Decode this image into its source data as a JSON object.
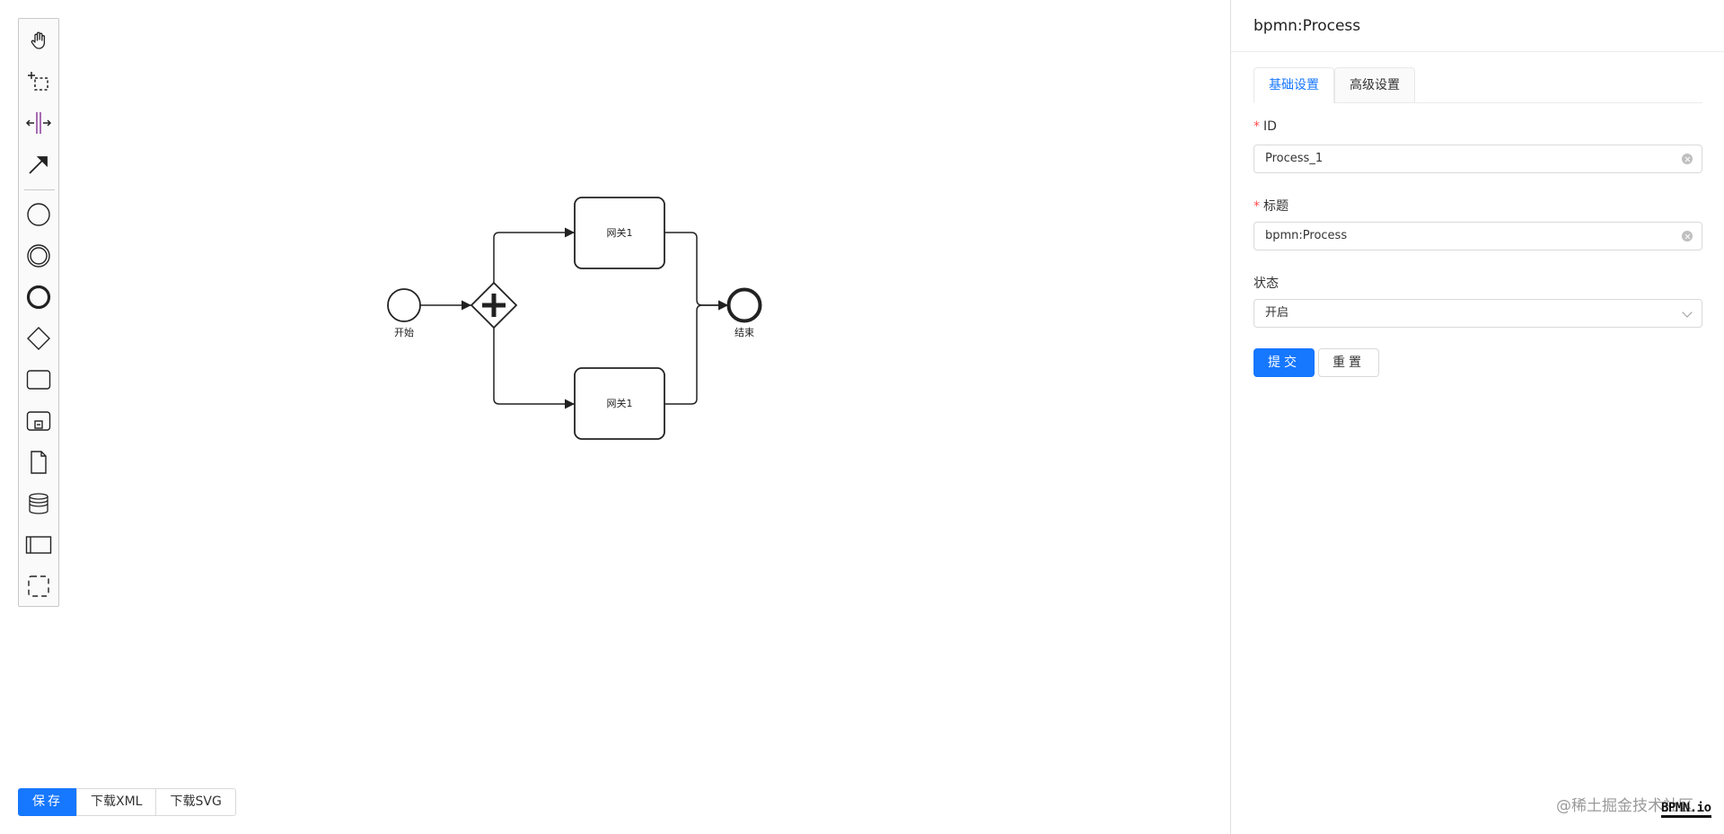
{
  "palette": {
    "tools": [
      {
        "icon": "hand-tool-icon"
      },
      {
        "icon": "lasso-tool-icon"
      },
      {
        "icon": "space-tool-icon"
      },
      {
        "icon": "global-connect-tool-icon"
      },
      {
        "icon": "start-event-icon"
      },
      {
        "icon": "intermediate-event-icon"
      },
      {
        "icon": "end-event-icon"
      },
      {
        "icon": "gateway-icon"
      },
      {
        "icon": "task-icon"
      },
      {
        "icon": "subprocess-icon"
      },
      {
        "icon": "data-object-icon"
      },
      {
        "icon": "data-store-icon"
      },
      {
        "icon": "participant-icon"
      },
      {
        "icon": "group-icon"
      }
    ]
  },
  "diagram": {
    "start_label": "开始",
    "end_label": "结束",
    "task1_label": "网关1",
    "task2_label": "网关1"
  },
  "toolbar": {
    "save_label": "保存",
    "download_xml_label": "下载XML",
    "download_svg_label": "下载SVG"
  },
  "panel": {
    "title": "bpmn:Process",
    "tabs": [
      {
        "label": "基础设置",
        "active": true
      },
      {
        "label": "高级设置",
        "active": false
      }
    ],
    "fields": {
      "id": {
        "label": "ID",
        "required": true,
        "value": "Process_1"
      },
      "title": {
        "label": "标题",
        "required": true,
        "value": "bpmn:Process"
      },
      "status": {
        "label": "状态",
        "value": "开启"
      }
    },
    "submit_label": "提交",
    "reset_label": "重置"
  },
  "watermark": "@稀土掘金技术社区",
  "logo": "BPMN.io",
  "colors": {
    "primary": "#1677ff",
    "required": "#ff4d4f"
  }
}
